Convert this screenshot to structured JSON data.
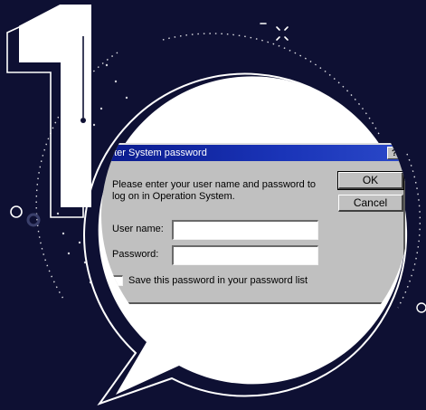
{
  "dialog": {
    "title": "nter System password",
    "help_glyph": "?",
    "prompt": "Please enter your user name and password to log on in Operation System.",
    "username_label": "User name:",
    "username_value": "",
    "password_label": "Password:",
    "password_value": "",
    "ok_label": "OK",
    "cancel_label": "Cancel",
    "save_password_label": "Save this password in your password list",
    "save_password_checked": false
  },
  "theme": {
    "background": "#0e1033",
    "bubble_fill": "#ffffff",
    "dialog_face": "#c0c0c0",
    "titlebar": "#0a1a8c"
  },
  "decor": {
    "big_numeral": "1"
  }
}
